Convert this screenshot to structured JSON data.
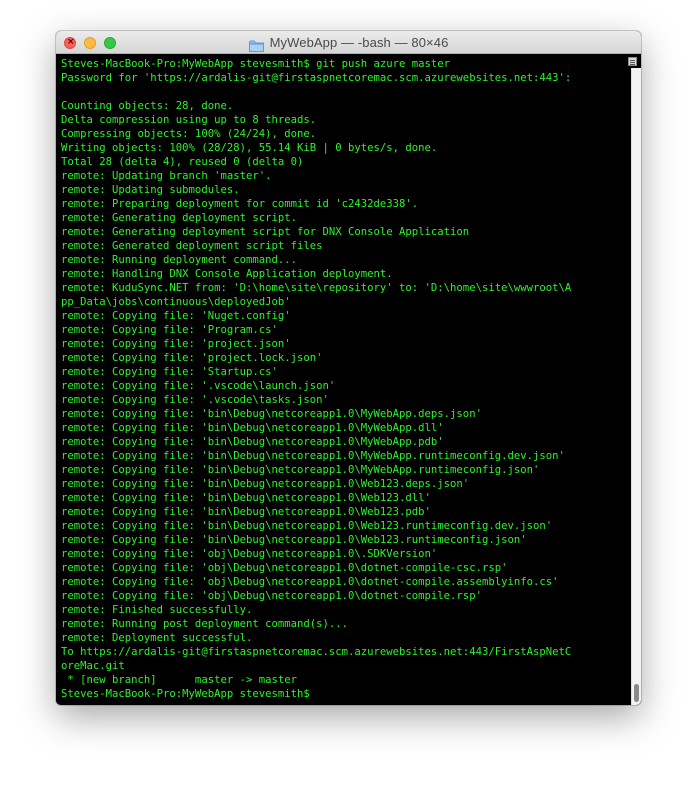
{
  "window": {
    "title": "MyWebApp — -bash — 80×46",
    "folder_icon": "folder-icon",
    "close_glyph": "×"
  },
  "colors": {
    "terminal_bg": "#000000",
    "terminal_fg": "#2cf22c",
    "close": "#fc605c",
    "minimize": "#fdbc40",
    "maximize": "#34c84a"
  },
  "scroll": {
    "position": 1.0
  },
  "terminal_lines": [
    "Steves-MacBook-Pro:MyWebApp stevesmith$ git push azure master",
    "Password for 'https://ardalis-git@firstaspnetcoremac.scm.azurewebsites.net:443':",
    "",
    "Counting objects: 28, done.",
    "Delta compression using up to 8 threads.",
    "Compressing objects: 100% (24/24), done.",
    "Writing objects: 100% (28/28), 55.14 KiB | 0 bytes/s, done.",
    "Total 28 (delta 4), reused 0 (delta 0)",
    "remote: Updating branch 'master'.",
    "remote: Updating submodules.",
    "remote: Preparing deployment for commit id 'c2432de338'.",
    "remote: Generating deployment script.",
    "remote: Generating deployment script for DNX Console Application",
    "remote: Generated deployment script files",
    "remote: Running deployment command...",
    "remote: Handling DNX Console Application deployment.",
    "remote: KuduSync.NET from: 'D:\\home\\site\\repository' to: 'D:\\home\\site\\wwwroot\\A",
    "pp_Data\\jobs\\continuous\\deployedJob'",
    "remote: Copying file: 'Nuget.config'",
    "remote: Copying file: 'Program.cs'",
    "remote: Copying file: 'project.json'",
    "remote: Copying file: 'project.lock.json'",
    "remote: Copying file: 'Startup.cs'",
    "remote: Copying file: '.vscode\\launch.json'",
    "remote: Copying file: '.vscode\\tasks.json'",
    "remote: Copying file: 'bin\\Debug\\netcoreapp1.0\\MyWebApp.deps.json'",
    "remote: Copying file: 'bin\\Debug\\netcoreapp1.0\\MyWebApp.dll'",
    "remote: Copying file: 'bin\\Debug\\netcoreapp1.0\\MyWebApp.pdb'",
    "remote: Copying file: 'bin\\Debug\\netcoreapp1.0\\MyWebApp.runtimeconfig.dev.json'",
    "remote: Copying file: 'bin\\Debug\\netcoreapp1.0\\MyWebApp.runtimeconfig.json'",
    "remote: Copying file: 'bin\\Debug\\netcoreapp1.0\\Web123.deps.json'",
    "remote: Copying file: 'bin\\Debug\\netcoreapp1.0\\Web123.dll'",
    "remote: Copying file: 'bin\\Debug\\netcoreapp1.0\\Web123.pdb'",
    "remote: Copying file: 'bin\\Debug\\netcoreapp1.0\\Web123.runtimeconfig.dev.json'",
    "remote: Copying file: 'bin\\Debug\\netcoreapp1.0\\Web123.runtimeconfig.json'",
    "remote: Copying file: 'obj\\Debug\\netcoreapp1.0\\.SDKVersion'",
    "remote: Copying file: 'obj\\Debug\\netcoreapp1.0\\dotnet-compile-csc.rsp'",
    "remote: Copying file: 'obj\\Debug\\netcoreapp1.0\\dotnet-compile.assemblyinfo.cs'",
    "remote: Copying file: 'obj\\Debug\\netcoreapp1.0\\dotnet-compile.rsp'",
    "remote: Finished successfully.",
    "remote: Running post deployment command(s)...",
    "remote: Deployment successful.",
    "To https://ardalis-git@firstaspnetcoremac.scm.azurewebsites.net:443/FirstAspNetC",
    "oreMac.git",
    " * [new branch]      master -> master",
    "Steves-MacBook-Pro:MyWebApp stevesmith$ "
  ]
}
